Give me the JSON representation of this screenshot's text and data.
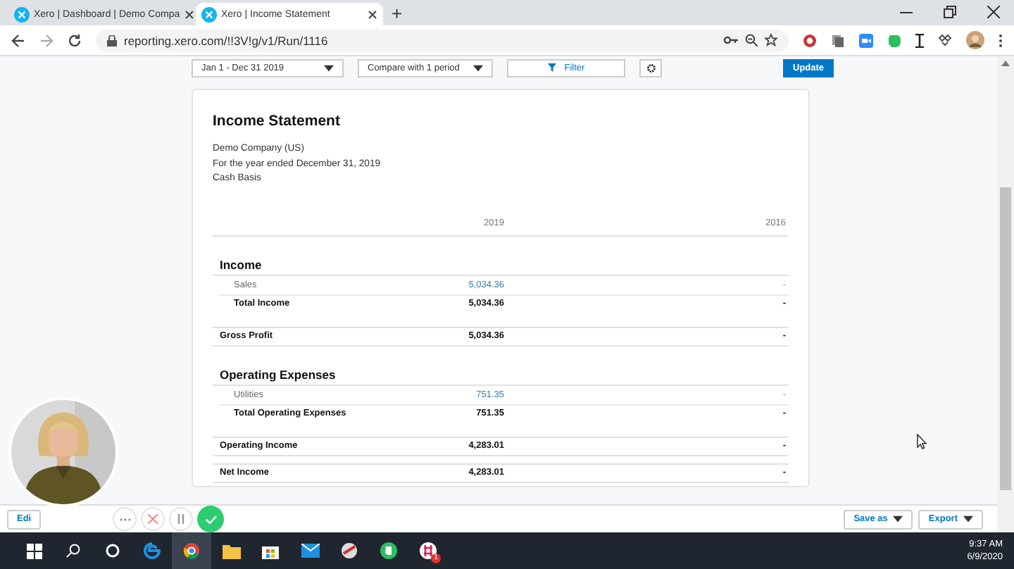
{
  "browser": {
    "tabs": [
      {
        "title": "Xero | Dashboard | Demo Compa",
        "selected": false
      },
      {
        "title": "Xero | Income Statement",
        "selected": true
      }
    ],
    "new_tab": "+",
    "url": "reporting.xero.com/!!3V!g/v1/Run/1116"
  },
  "report_controls": {
    "date_range": "Jan 1 - Dec 31 2019",
    "compare": "Compare with 1 period",
    "filter": "Filter",
    "update": "Update"
  },
  "report": {
    "title": "Income Statement",
    "subtitle_lines": [
      "Demo Company (US)",
      "For the year ended December 31, 2019",
      "Cash Basis"
    ],
    "columns": [
      "2019",
      "2016"
    ],
    "rows": [
      {
        "kind": "section",
        "label": "Income"
      },
      {
        "kind": "account",
        "label": "Sales",
        "values": [
          "5,034.36",
          "-"
        ]
      },
      {
        "kind": "total",
        "label": "Total Income",
        "values": [
          "5,034.36",
          "-"
        ]
      },
      {
        "kind": "summary",
        "label": "Gross Profit",
        "values": [
          "5,034.36",
          "-"
        ]
      },
      {
        "kind": "section",
        "label": "Operating Expenses"
      },
      {
        "kind": "account",
        "label": "Utilities",
        "values": [
          "751.35",
          "-"
        ]
      },
      {
        "kind": "total",
        "label": "Total Operating Expenses",
        "values": [
          "751.35",
          "-"
        ]
      },
      {
        "kind": "summary",
        "label": "Operating Income",
        "values": [
          "4,283.01",
          "-"
        ]
      },
      {
        "kind": "summary",
        "label": "Net Income",
        "values": [
          "4,283.01",
          "-"
        ]
      }
    ]
  },
  "footer": {
    "edit": "Edi",
    "save_as": "Save as",
    "export": "Export"
  },
  "taskbar": {
    "badge": "1",
    "time": "9:37 AM",
    "date": "6/9/2020"
  }
}
